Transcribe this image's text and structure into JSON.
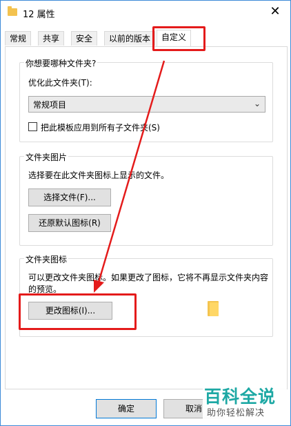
{
  "window": {
    "title": "12 属性",
    "close_glyph": "✕"
  },
  "tabs": [
    {
      "label": "常规"
    },
    {
      "label": "共享"
    },
    {
      "label": "安全"
    },
    {
      "label": "以前的版本"
    },
    {
      "label": "自定义",
      "active": true
    }
  ],
  "optimize_group": {
    "title": "你想要哪种文件夹?",
    "optimize_label": "优化此文件夹(T):",
    "selected_option": "常规项目",
    "checkbox_label": "把此模板应用到所有子文件夹(S)",
    "checkbox_checked": false
  },
  "folder_pictures": {
    "title": "文件夹图片",
    "description": "选择要在此文件夹图标上显示的文件。",
    "choose_file_button": "选择文件(F)...",
    "restore_default_button": "还原默认图标(R)"
  },
  "folder_icons": {
    "title": "文件夹图标",
    "description_line1": "可以更改文件夹图标。如果更改了图标，它将不再显示文件夹内容",
    "description_line2": "的预览。",
    "change_icon_button": "更改图标(I)..."
  },
  "footer": {
    "ok_button": "确定",
    "cancel_button": "取消"
  },
  "watermark": {
    "brand": "百科全说",
    "tagline": "助你轻松解决"
  },
  "colors": {
    "accent_border": "#3c8ad8",
    "annotation_red": "#e41b1b",
    "watermark_teal": "#1da8a4",
    "folder_yellow": "#f3c24f"
  }
}
